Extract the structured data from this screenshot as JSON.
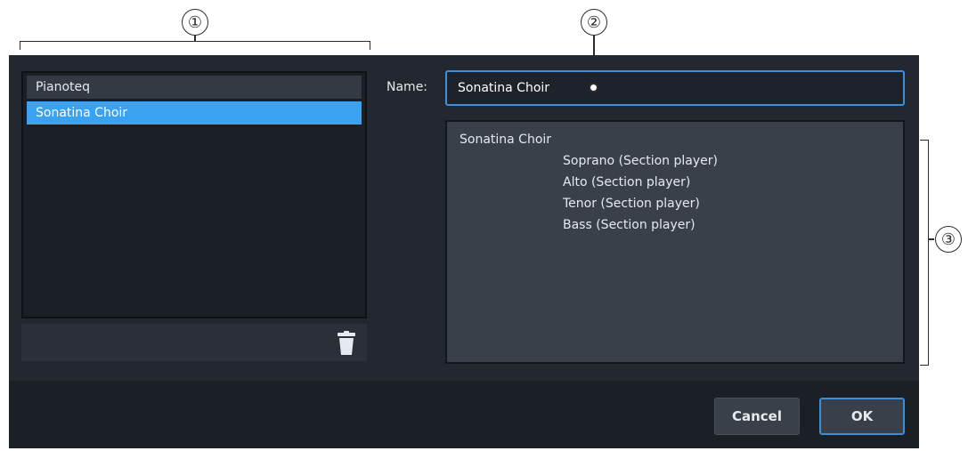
{
  "callouts": {
    "one": "①",
    "two": "②",
    "three": "③"
  },
  "list": {
    "items": [
      {
        "label": "Pianoteq",
        "selected": false
      },
      {
        "label": "Sonatina Choir",
        "selected": true
      }
    ],
    "delete_icon": "trash-icon"
  },
  "form": {
    "name_label": "Name:",
    "name_value": "Sonatina Choir"
  },
  "details": {
    "title": "Sonatina Choir",
    "lines": [
      "Soprano (Section player)",
      "Alto (Section player)",
      "Tenor (Section player)",
      "Bass (Section player)"
    ]
  },
  "buttons": {
    "cancel": "Cancel",
    "ok": "OK"
  },
  "colors": {
    "selection": "#3aa2f0",
    "focus_border": "#3c8fda",
    "dialog_bg": "#232830"
  }
}
